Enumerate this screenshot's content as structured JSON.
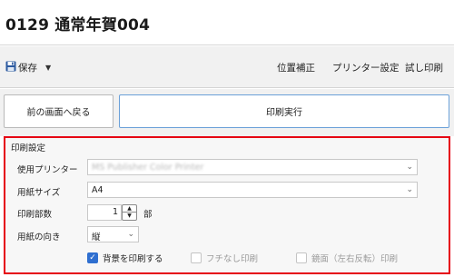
{
  "header": {
    "title": "0129 通常年賀004"
  },
  "toolbar": {
    "save_label": "保存",
    "position_label": "位置補正",
    "printer_settings_label": "プリンター設定",
    "test_print_label": "試し印刷"
  },
  "actions": {
    "back_label": "前の画面へ戻る",
    "print_label": "印刷実行"
  },
  "settings": {
    "section_title": "印刷設定",
    "printer": {
      "label": "使用プリンター",
      "value": "MS Publisher Color Printer"
    },
    "paper_size": {
      "label": "用紙サイズ",
      "value": "A4"
    },
    "copies": {
      "label": "印刷部数",
      "value": "1",
      "unit": "部"
    },
    "orientation": {
      "label": "用紙の向き",
      "value": "縦"
    },
    "print_background": {
      "label": "背景を印刷する",
      "checked": true
    },
    "borderless": {
      "label": "フチなし印刷",
      "checked": false,
      "enabled": false
    },
    "mirror": {
      "label": "鏡面（左右反転）印刷",
      "checked": false,
      "enabled": false
    }
  },
  "colors": {
    "accent": "#2f6fd0",
    "highlight_frame": "#e60012",
    "save_icon": "#2c5aa0"
  }
}
